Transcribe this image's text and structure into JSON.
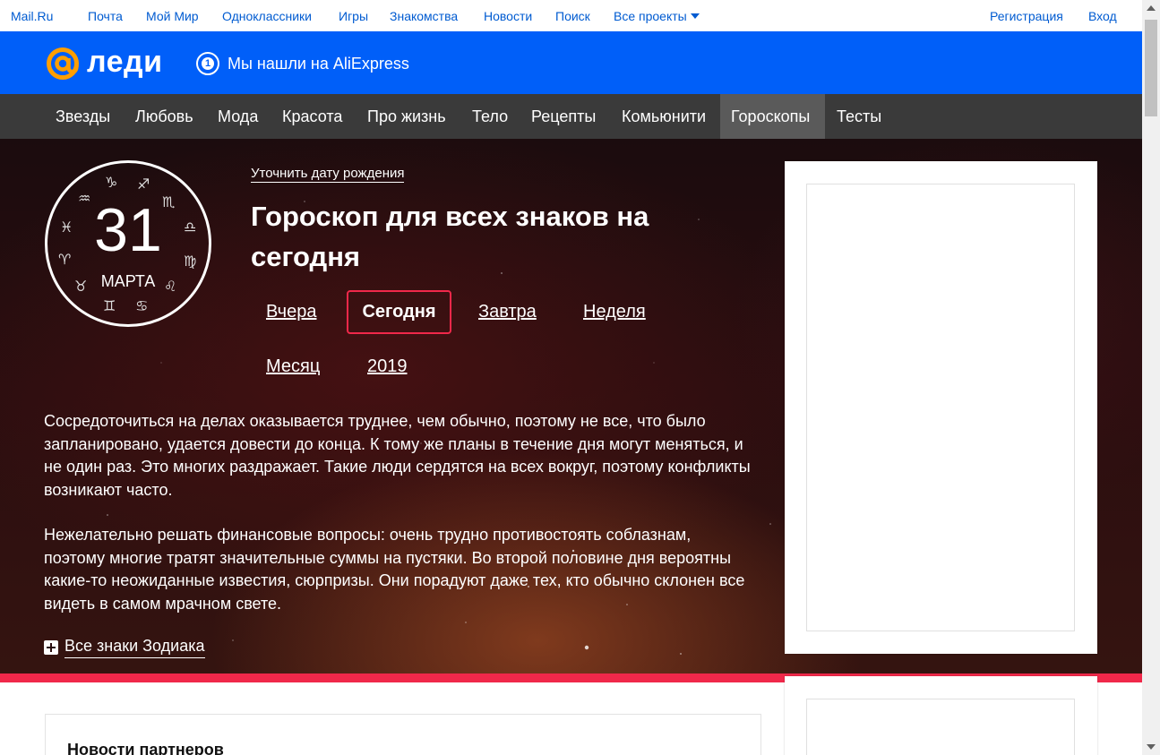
{
  "portal": {
    "links": [
      "Mail.Ru",
      "Почта",
      "Мой Мир",
      "Одноклассники",
      "Игры",
      "Знакомства",
      "Новости",
      "Поиск",
      "Все проекты"
    ],
    "register": "Регистрация",
    "login": "Вход"
  },
  "brand": {
    "logo_text": "леди",
    "promo_text": "Мы нашли на AliExpress",
    "promo_badge": "1"
  },
  "nav": {
    "items": [
      "Звезды",
      "Любовь",
      "Мода",
      "Красота",
      "Про жизнь",
      "Тело",
      "Рецепты",
      "Комьюнити",
      "Гороскопы",
      "Тесты"
    ],
    "active": "Гороскопы"
  },
  "horoscope": {
    "date_day": "31",
    "date_month": "МАРТА",
    "zodiac_symbols": [
      "♒",
      "♑",
      "♐",
      "♓",
      "♏",
      "♈",
      "♎",
      "♉",
      "♍",
      "♊",
      "♋",
      "♌"
    ],
    "clarify_link": "Уточнить дату рождения",
    "title": "Гороскоп для всех знаков на сегодня",
    "periods": [
      "Вчера",
      "Сегодня",
      "Завтра",
      "Неделя",
      "Месяц",
      "2019"
    ],
    "active_period": "Сегодня",
    "paragraph1": "Сосредоточиться на делах оказывается труднее, чем обычно, поэтому не все, что было запланировано, удается довести до конца. К тому же планы в течение дня могут меняться, и не один раз. Это многих раздражает. Такие люди сердятся на всех вокруг, поэтому конфликты возникают часто.",
    "paragraph2": "Нежелательно решать финансовые вопросы: очень трудно противостоять соблазнам, поэтому многие тратят значительные суммы на пустяки. Во второй половине дня вероятны какие-то неожиданные известия, сюрпризы. Они порадуют даже тех, кто обычно склонен все видеть в самом мрачном свете.",
    "all_signs": "Все знаки Зодиака"
  },
  "partners": {
    "heading": "Новости партнеров"
  },
  "colors": {
    "brand_blue": "#005ff9",
    "link_blue": "#005bd1",
    "nav_bg": "#3a3a3a",
    "nav_active": "#5a5a5a",
    "accent_pink": "#f0284a"
  }
}
